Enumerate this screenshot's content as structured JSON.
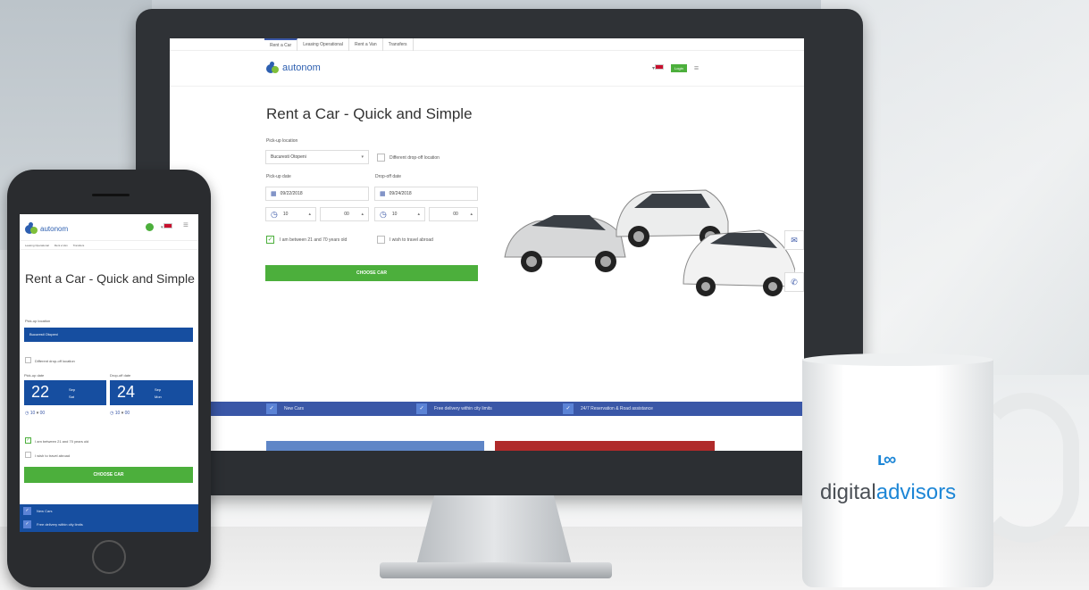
{
  "desktop": {
    "top_nav": [
      "Rent a Car",
      "Leasing Operational",
      "Rent a Van",
      "Transfers"
    ],
    "logo_text": "autonom",
    "login_label": "Login",
    "title": "Rent a Car - Quick and Simple",
    "pickup_location_label": "Pick-up location",
    "pickup_location_value": "Bucuresti Otopeni",
    "different_dropoff_label": "Different drop-off location",
    "pickup_date_label": "Pick-up date",
    "pickup_date_value": "09/22/2018",
    "dropoff_date_label": "Drop-off date",
    "dropoff_date_value": "09/24/2018",
    "pickup_hour": "10",
    "pickup_min": "00",
    "dropoff_hour": "10",
    "dropoff_min": "00",
    "age_label": "I am between 21 and 70 years old",
    "abroad_label": "I wish to travel abroad",
    "choose_button": "CHOOSE CAR",
    "features": [
      "New Cars",
      "Free delivery within city limits",
      "24/7 Reservation & Road assistance"
    ]
  },
  "mobile": {
    "logo_text": "autonom",
    "nav": [
      "Leasing Operational",
      "Rent a Van",
      "Transfers"
    ],
    "title": "Rent a Car - Quick and Simple",
    "pickup_location_label": "Pick-up location",
    "pickup_location_value": "Bucuresti Otopeni",
    "different_dropoff_label": "Different drop-off location",
    "pickup_date_label": "Pick-up date",
    "dropoff_date_label": "Drop-off date",
    "pickup_day": "22",
    "dropoff_day": "24",
    "month_label": "Sep",
    "pickup_weekday": "Sat",
    "dropoff_weekday": "Mon",
    "hour": "10",
    "min": "00",
    "age_label": "I am between 21 and 70 years old",
    "abroad_label": "I wish to travel abroad",
    "choose_button": "CHOOSE CAR",
    "features": [
      "New Cars",
      "Free delivery within city limits"
    ]
  },
  "mug": {
    "brand_a": "digital",
    "brand_b": "advisors",
    "icon": "infinity-logo-icon"
  },
  "colors": {
    "primary_blue": "#3a57a7",
    "green": "#4caf3c",
    "mug_blue": "#1d86d6"
  }
}
